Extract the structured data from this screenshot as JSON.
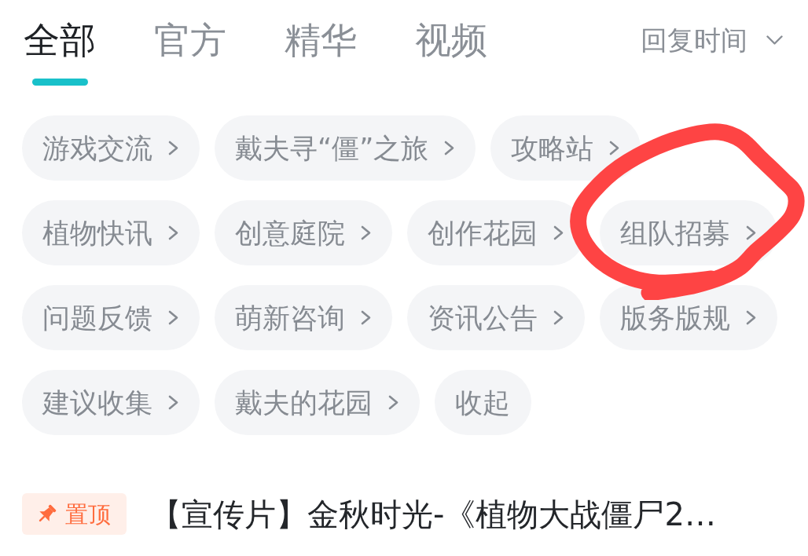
{
  "tabs": [
    {
      "label": "全部",
      "selected": true
    },
    {
      "label": "官方",
      "selected": false
    },
    {
      "label": "精华",
      "selected": false
    },
    {
      "label": "视频",
      "selected": false
    }
  ],
  "sort": {
    "label": "回复时间"
  },
  "categories": [
    {
      "label": "游戏交流",
      "kind": "link"
    },
    {
      "label": "戴夫寻“僵”之旅",
      "kind": "link"
    },
    {
      "label": "攻略站",
      "kind": "link"
    },
    {
      "label": "植物快讯",
      "kind": "link"
    },
    {
      "label": "创意庭院",
      "kind": "link"
    },
    {
      "label": "创作花园",
      "kind": "link"
    },
    {
      "label": "组队招募",
      "kind": "link"
    },
    {
      "label": "问题反馈",
      "kind": "link"
    },
    {
      "label": "萌新咨询",
      "kind": "link"
    },
    {
      "label": "资讯公告",
      "kind": "link"
    },
    {
      "label": "版务版规",
      "kind": "link"
    },
    {
      "label": "建议收集",
      "kind": "link"
    },
    {
      "label": "戴夫的花园",
      "kind": "link"
    },
    {
      "label": "收起",
      "kind": "collapse"
    }
  ],
  "pinned_post": {
    "badge": "置顶",
    "title": "【宣传片】金秋时光-《植物大战僵尸2…"
  },
  "annotation": {
    "kind": "freehand_loop"
  }
}
